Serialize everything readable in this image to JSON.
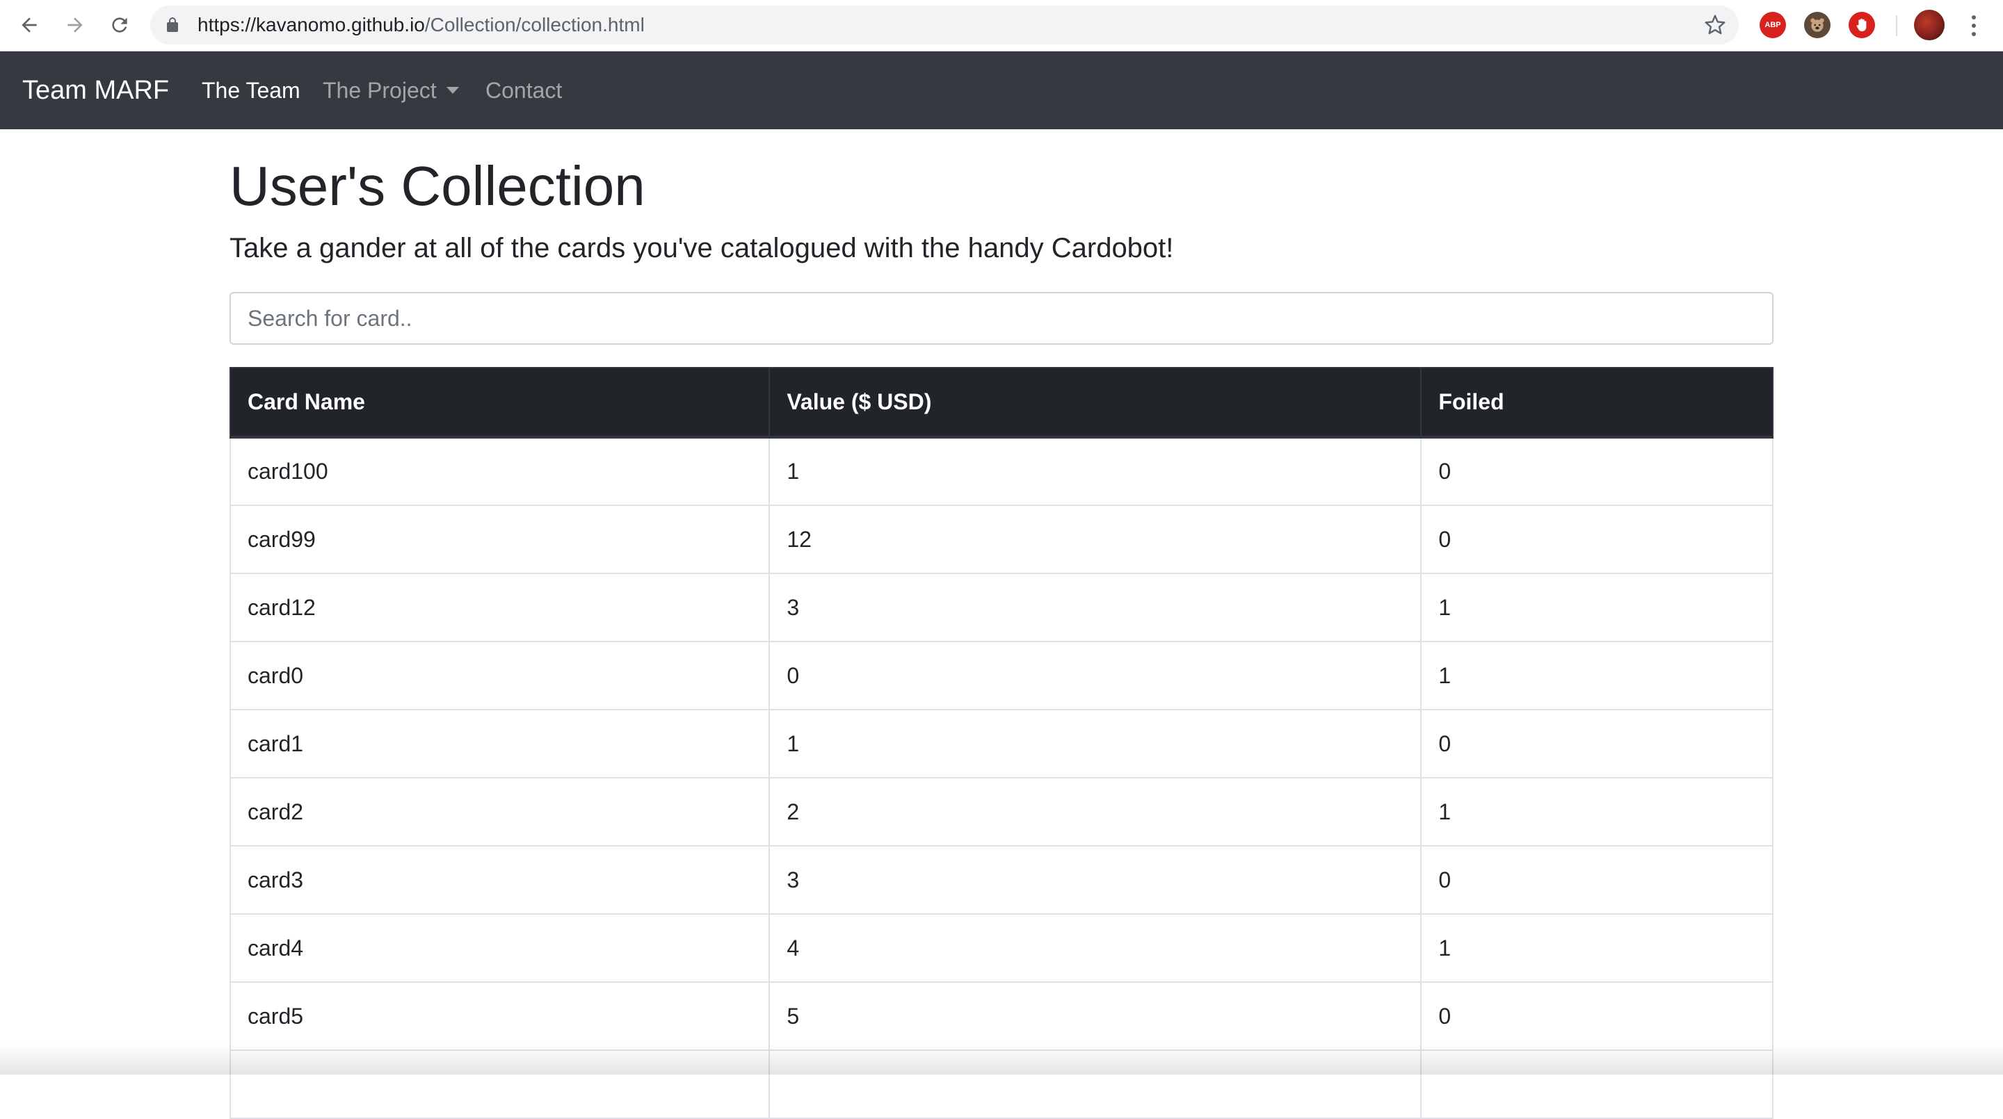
{
  "browser": {
    "url_host": "https://kavanomo.github.io",
    "url_path": "/Collection/collection.html",
    "icons": {
      "back": "arrow-left-icon",
      "forward": "arrow-right-icon",
      "reload": "reload-icon",
      "lock": "lock-icon",
      "bookmark": "star-icon",
      "ext_adblock_label": "ABP",
      "menu": "vertical-dots-icon"
    }
  },
  "navbar": {
    "brand": "Team MARF",
    "links": [
      {
        "label": "The Team",
        "active": true
      },
      {
        "label": "The Project",
        "dropdown": true
      },
      {
        "label": "Contact"
      }
    ],
    "colors": {
      "background": "#343a40"
    }
  },
  "main": {
    "title": "User's Collection",
    "lead": "Take a gander at all of the cards you've catalogued with the handy Cardobot!",
    "search": {
      "placeholder": "Search for card..",
      "value": ""
    },
    "table": {
      "columns": [
        "Card Name",
        "Value ($ USD)",
        "Foiled"
      ],
      "rows": [
        [
          "card100",
          "1",
          "0"
        ],
        [
          "card99",
          "12",
          "0"
        ],
        [
          "card12",
          "3",
          "1"
        ],
        [
          "card0",
          "0",
          "1"
        ],
        [
          "card1",
          "1",
          "0"
        ],
        [
          "card2",
          "2",
          "1"
        ],
        [
          "card3",
          "3",
          "0"
        ],
        [
          "card4",
          "4",
          "1"
        ],
        [
          "card5",
          "5",
          "0"
        ]
      ]
    }
  }
}
